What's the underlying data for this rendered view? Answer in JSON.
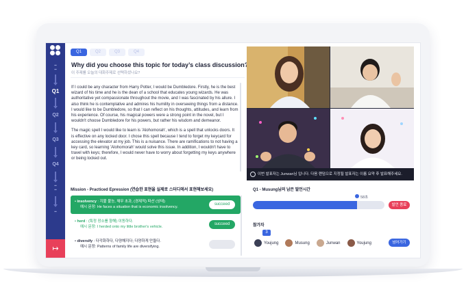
{
  "rail": {
    "items": [
      {
        "label": "Q1",
        "active": true
      },
      {
        "label": "Q2",
        "active": false
      },
      {
        "label": "Q3",
        "active": false
      },
      {
        "label": "Q4",
        "active": false
      }
    ],
    "exit_icon": "exit-icon"
  },
  "question": {
    "tabs": [
      "Q1",
      "Q2",
      "Q3",
      "Q4"
    ],
    "title": "Why did you choose this topic for today’s class discussion?",
    "subtitle": "이 주제를 오늘의 대화주제로 선택하셨나요?"
  },
  "essay": {
    "paragraphs": [
      "If I could be any character from Harry Potter, I would be Dumbledore. Firstly, he is the best wizard of his time and he is the dean of a school that educates young wizards. He was authoritative yet compassionate throughout the movie, and I was fascinated by his allure. I also think he is contemplative and admires his humility in overseeing things from a distance. I would like to be Dumbledore, so that I can reflect on his thoughts, attitudes, and learn from his experience. Of course, his magical powers were a strong point in the novel, but I wouldn't choose Dumbledore for his powers, but rather his wisdom and demeanor.",
      "The magic spell I would like to learn is 'Alohomorah', which is a spell that unlocks doors. It is effective on any locked door. I chose this spell because I tend to forget my keycard for accessing the elevator at my job. This is a nuisance. There are ramifications to not having a key card, so learning 'Alohomorah' would solve this issue. In addition, I wouldn't have to travel with keys; therefore, I would never have to worry about forgetting my keys anywhere or being locked out."
    ]
  },
  "video": {
    "caption": "이번 발표자는 Junwan님 입니다. 다음 랜덤으로 지정될 발표자는 이름 요약 후 발표해주세요."
  },
  "mission": {
    "title": "Mission - Practiced Epression (연습한 표현을 실제로 스터디에서 표현해보세요)",
    "items": [
      {
        "word": "insolvency",
        "meaning": " : 지불 불능, 채무 초과, (경제적) 파산 (상태)",
        "example": "예시 문장: He faces a situation that is economic insolvency.",
        "status": "succeed",
        "state": "done"
      },
      {
        "word": "herd",
        "meaning": " : (특정 장소를 향해) 이동하다.",
        "example": "예시 문장: I herded onto my little brother's vehicle.",
        "status": "succeed",
        "state": "part"
      },
      {
        "word": "diversify",
        "meaning": " : 다각화하다, 다양해지다; 다양하게 만들다.",
        "example": "예시 문장: Patterns of family life are diversifying.",
        "status": "succeed",
        "state": "none"
      }
    ]
  },
  "speaking": {
    "title": "Q1 - Musung님의 남은 발언시간",
    "remaining": "58초",
    "progress": 0.79,
    "end_button": "발언 종료",
    "participants_title": "참가자",
    "badge": "3",
    "participants": [
      {
        "name": "Youjung",
        "color": "#3b3f55"
      },
      {
        "name": "Musung",
        "color": "#b07a5a"
      },
      {
        "name": "Junwan",
        "color": "#c9a88f"
      },
      {
        "name": "Youjung",
        "color": "#8a5a48"
      }
    ],
    "next_button": "넘어가기"
  },
  "colors": {
    "rail": "#2c3a8c",
    "primary": "#3a66e0",
    "success": "#23a765",
    "danger": "#e8405a"
  }
}
